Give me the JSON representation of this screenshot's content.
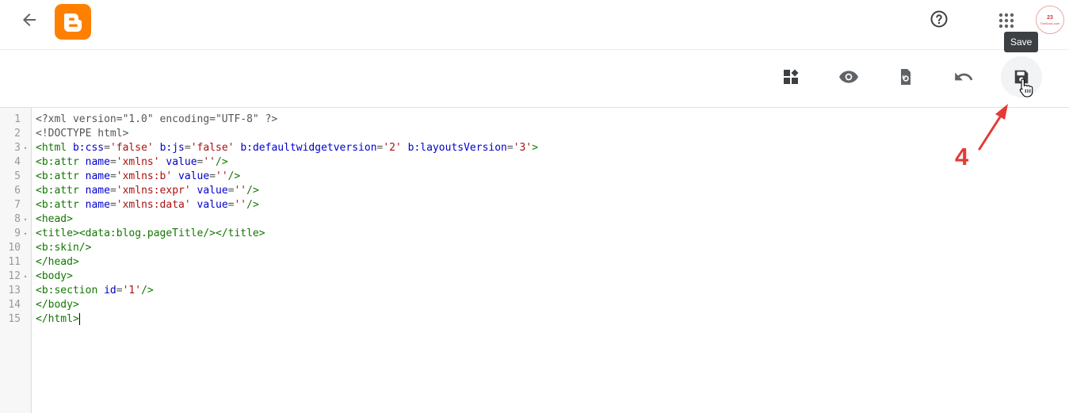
{
  "header": {
    "help_icon": "help-circle-icon",
    "apps_icon": "apps-grid-icon",
    "back_icon": "arrow-back-icon",
    "logo_icon": "blogger-logo",
    "avatar": {
      "line1": "23",
      "line2": "TheDocs.com"
    }
  },
  "tooltip": {
    "text": "Save"
  },
  "toolbar": {
    "widgets_icon": "widgets-icon",
    "preview_icon": "eye-icon",
    "restore_icon": "restore-icon",
    "undo_icon": "undo-icon",
    "save_icon": "save-icon"
  },
  "annotation": {
    "step": "4",
    "color": "#e53935"
  },
  "editor": {
    "lines": [
      {
        "n": "1",
        "fold": ""
      },
      {
        "n": "2",
        "fold": ""
      },
      {
        "n": "3",
        "fold": "▾"
      },
      {
        "n": "4",
        "fold": ""
      },
      {
        "n": "5",
        "fold": ""
      },
      {
        "n": "6",
        "fold": ""
      },
      {
        "n": "7",
        "fold": ""
      },
      {
        "n": "8",
        "fold": "▾"
      },
      {
        "n": "9",
        "fold": "▾"
      },
      {
        "n": "10",
        "fold": ""
      },
      {
        "n": "11",
        "fold": ""
      },
      {
        "n": "12",
        "fold": "▾"
      },
      {
        "n": "13",
        "fold": ""
      },
      {
        "n": "14",
        "fold": ""
      },
      {
        "n": "15",
        "fold": ""
      }
    ],
    "code": [
      [
        {
          "c": "m",
          "t": "<?xml version=\"1.0\" encoding=\"UTF-8\" ?>"
        }
      ],
      [
        {
          "c": "m",
          "t": "<!DOCTYPE html>"
        }
      ],
      [
        {
          "c": "t",
          "t": "<html "
        },
        {
          "c": "a",
          "t": "b:css"
        },
        {
          "c": "m",
          "t": "="
        },
        {
          "c": "s",
          "t": "'false'"
        },
        {
          "c": "m",
          "t": " "
        },
        {
          "c": "a",
          "t": "b:js"
        },
        {
          "c": "m",
          "t": "="
        },
        {
          "c": "s",
          "t": "'false'"
        },
        {
          "c": "m",
          "t": " "
        },
        {
          "c": "a",
          "t": "b:defaultwidgetversion"
        },
        {
          "c": "m",
          "t": "="
        },
        {
          "c": "s",
          "t": "'2'"
        },
        {
          "c": "m",
          "t": " "
        },
        {
          "c": "a",
          "t": "b:layoutsVersion"
        },
        {
          "c": "m",
          "t": "="
        },
        {
          "c": "s",
          "t": "'3'"
        },
        {
          "c": "t",
          "t": ">"
        }
      ],
      [
        {
          "c": "t",
          "t": "<b:attr "
        },
        {
          "c": "a",
          "t": "name"
        },
        {
          "c": "m",
          "t": "="
        },
        {
          "c": "s",
          "t": "'xmlns'"
        },
        {
          "c": "m",
          "t": " "
        },
        {
          "c": "a",
          "t": "value"
        },
        {
          "c": "m",
          "t": "="
        },
        {
          "c": "s",
          "t": "''"
        },
        {
          "c": "t",
          "t": "/>"
        }
      ],
      [
        {
          "c": "t",
          "t": "<b:attr "
        },
        {
          "c": "a",
          "t": "name"
        },
        {
          "c": "m",
          "t": "="
        },
        {
          "c": "s",
          "t": "'xmlns:b'"
        },
        {
          "c": "m",
          "t": " "
        },
        {
          "c": "a",
          "t": "value"
        },
        {
          "c": "m",
          "t": "="
        },
        {
          "c": "s",
          "t": "''"
        },
        {
          "c": "t",
          "t": "/>"
        }
      ],
      [
        {
          "c": "t",
          "t": "<b:attr "
        },
        {
          "c": "a",
          "t": "name"
        },
        {
          "c": "m",
          "t": "="
        },
        {
          "c": "s",
          "t": "'xmlns:expr'"
        },
        {
          "c": "m",
          "t": " "
        },
        {
          "c": "a",
          "t": "value"
        },
        {
          "c": "m",
          "t": "="
        },
        {
          "c": "s",
          "t": "''"
        },
        {
          "c": "t",
          "t": "/>"
        }
      ],
      [
        {
          "c": "t",
          "t": "<b:attr "
        },
        {
          "c": "a",
          "t": "name"
        },
        {
          "c": "m",
          "t": "="
        },
        {
          "c": "s",
          "t": "'xmlns:data'"
        },
        {
          "c": "m",
          "t": " "
        },
        {
          "c": "a",
          "t": "value"
        },
        {
          "c": "m",
          "t": "="
        },
        {
          "c": "s",
          "t": "''"
        },
        {
          "c": "t",
          "t": "/>"
        }
      ],
      [
        {
          "c": "t",
          "t": "<head>"
        }
      ],
      [
        {
          "c": "t",
          "t": "<title><data:blog.pageTitle/></title>"
        }
      ],
      [
        {
          "c": "t",
          "t": "<b:skin/>"
        }
      ],
      [
        {
          "c": "t",
          "t": "</head>"
        }
      ],
      [
        {
          "c": "t",
          "t": "<body>"
        }
      ],
      [
        {
          "c": "t",
          "t": "<b:section "
        },
        {
          "c": "a",
          "t": "id"
        },
        {
          "c": "m",
          "t": "="
        },
        {
          "c": "s",
          "t": "'1'"
        },
        {
          "c": "t",
          "t": "/>"
        }
      ],
      [
        {
          "c": "t",
          "t": "</body>"
        }
      ],
      [
        {
          "c": "t",
          "t": "</html>"
        }
      ]
    ]
  }
}
